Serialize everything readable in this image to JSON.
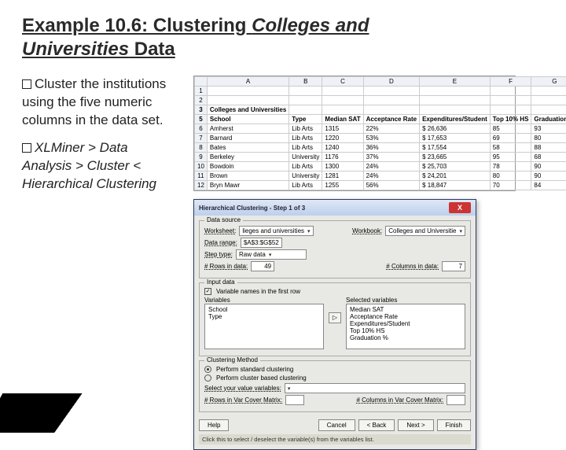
{
  "title": {
    "pre": "Example 10.6: Clustering ",
    "italic1": "Colleges and",
    "italic2": "Universities",
    "post": " Data"
  },
  "bullets": [
    "Cluster the institutions using the five numeric columns in the data set.",
    "XLMiner > Data Analysis > Cluster < Hierarchical Clustering"
  ],
  "sheet": {
    "cols": [
      "",
      "A",
      "B",
      "C",
      "D",
      "E",
      "F",
      "G"
    ],
    "blank_rows": [
      "1",
      "2"
    ],
    "header_row": {
      "num": "3",
      "cells": [
        "Colleges and Universities",
        "",
        "",
        "",
        "",
        "",
        ""
      ]
    },
    "header_row2": {
      "num": "5",
      "cells": [
        "School",
        "Type",
        "Median SAT",
        "Acceptance Rate",
        "Expenditures/Student",
        "Top 10% HS",
        "Graduation %"
      ]
    },
    "rows": [
      {
        "num": "6",
        "cells": [
          "Amherst",
          "Lib Arts",
          "1315",
          "22%",
          "$   26,636",
          "85",
          "93"
        ]
      },
      {
        "num": "7",
        "cells": [
          "Barnard",
          "Lib Arts",
          "1220",
          "53%",
          "$   17,653",
          "69",
          "80"
        ]
      },
      {
        "num": "8",
        "cells": [
          "Bates",
          "Lib Arts",
          "1240",
          "36%",
          "$   17,554",
          "58",
          "88"
        ]
      },
      {
        "num": "9",
        "cells": [
          "Berkeley",
          "University",
          "1176",
          "37%",
          "$   23,665",
          "95",
          "68"
        ]
      },
      {
        "num": "10",
        "cells": [
          "Bowdoin",
          "Lib Arts",
          "1300",
          "24%",
          "$   25,703",
          "78",
          "90"
        ]
      },
      {
        "num": "11",
        "cells": [
          "Brown",
          "University",
          "1281",
          "24%",
          "$   24,201",
          "80",
          "90"
        ]
      },
      {
        "num": "12",
        "cells": [
          "Bryn Mawr",
          "Lib Arts",
          "1255",
          "56%",
          "$   18,847",
          "70",
          "84"
        ]
      }
    ]
  },
  "dlg": {
    "title": "Hierarchical Clustering - Step 1 of 3",
    "ds": {
      "legend": "Data source",
      "worksheet_label": "Worksheet:",
      "worksheet": "lieges and universities",
      "workbook_label": "Workbook:",
      "workbook": "Colleges and Universitie",
      "range_label": "Data range:",
      "range": "$A$3:$G$52",
      "steptype_label": "Step type:",
      "steptype": "Raw data",
      "rows_label": "# Rows in data:",
      "rows": "49",
      "cols_label": "# Columns in data:",
      "cols": "7"
    },
    "inputdata": {
      "legend": "Input data",
      "chk": "Variable names in the first row",
      "vars_label": "Variables",
      "vars": [
        "School",
        "Type"
      ],
      "sel_label": "Selected variables",
      "sel": [
        "Median SAT",
        "Acceptance Rate",
        "Expenditures/Student",
        "Top 10% HS",
        "Graduation %"
      ]
    },
    "method": {
      "legend": "Clustering Method",
      "r1": "Perform standard clustering",
      "r2": "Perform cluster based clustering",
      "sel_label": "Select your value variables:",
      "rows_label": "# Rows in Var Cover Matrix:",
      "cols_label": "# Columns in Var Cover Matrix:"
    },
    "btns": [
      "Help",
      "Cancel",
      "< Back",
      "Next >",
      "Finish"
    ],
    "status": "Click this to select / deselect the variable(s) from the variables list."
  }
}
